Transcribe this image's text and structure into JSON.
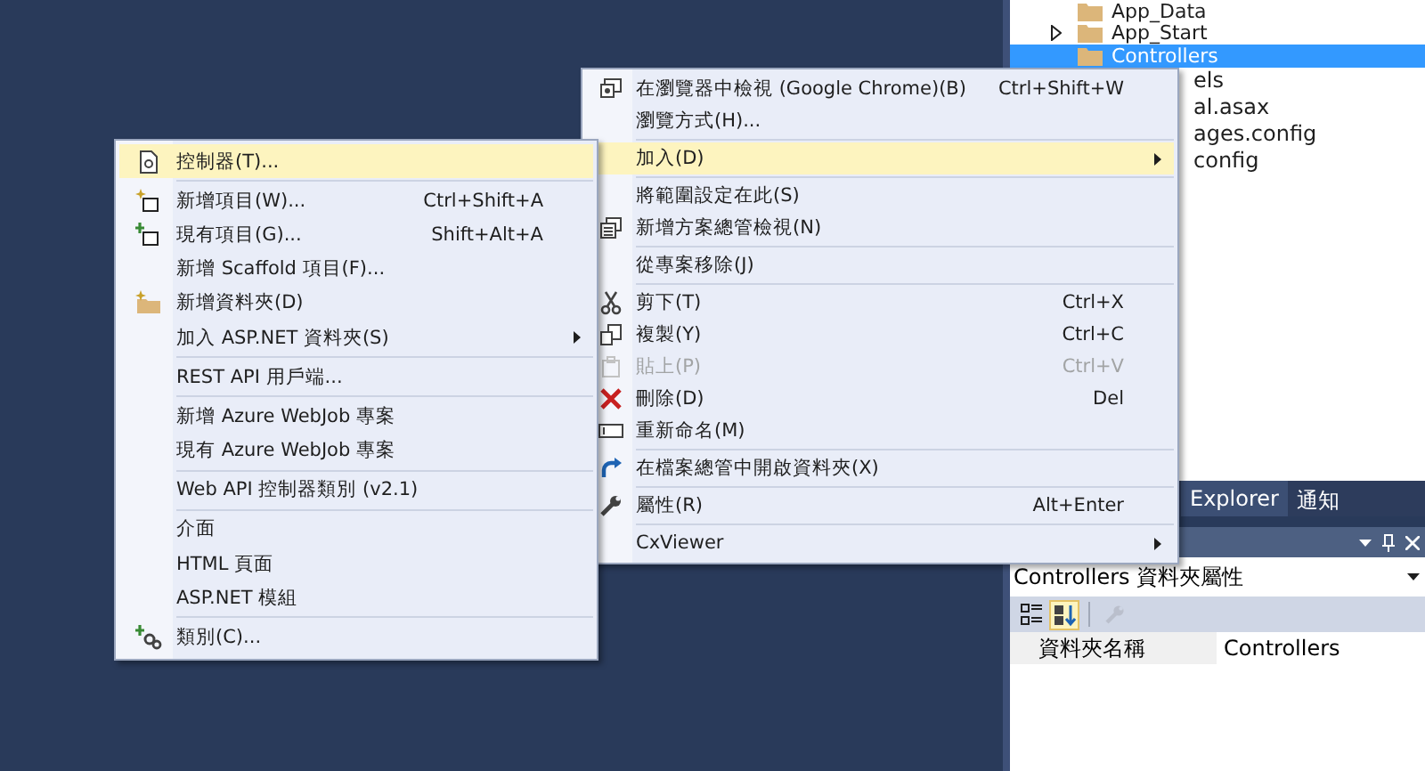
{
  "solution_explorer": {
    "items": [
      {
        "label": "App_Data",
        "kind": "folder",
        "selected": false
      },
      {
        "label": "App_Start",
        "kind": "collapsed-folder",
        "selected": false
      },
      {
        "label": "Controllers",
        "kind": "folder",
        "selected": true
      },
      {
        "label": "els",
        "kind": "partial",
        "selected": false
      },
      {
        "label": "al.asax",
        "kind": "partial",
        "selected": false
      },
      {
        "label": "ages.config",
        "kind": "partial",
        "selected": false
      },
      {
        "label": "config",
        "kind": "partial",
        "selected": false
      }
    ]
  },
  "tool_tabs": [
    {
      "label": "Explorer",
      "selected": true
    },
    {
      "label": "通知",
      "selected": false
    }
  ],
  "properties_panel": {
    "header": "Controllers 資料夾屬性",
    "toolbar": [
      {
        "kind": "categorized",
        "selected": false,
        "disabled": false
      },
      {
        "kind": "alphabetical",
        "selected": true,
        "disabled": false
      },
      {
        "kind": "property-pages",
        "selected": false,
        "disabled": true
      }
    ],
    "rows": [
      {
        "name": "資料夾名稱",
        "value": "Controllers"
      }
    ]
  },
  "menus": [
    {
      "items": [
        {
          "kind": "item",
          "label": "在瀏覽器中檢視 (Google Chrome)(B)",
          "shortcut": "Ctrl+Shift+W",
          "submenu": false,
          "selected": false,
          "disabled": false
        },
        {
          "kind": "item",
          "label": "瀏覽方式(H)...",
          "submenu": false,
          "selected": false,
          "disabled": false
        },
        {
          "kind": "separator"
        },
        {
          "kind": "item",
          "label": "加入(D)",
          "submenu": true,
          "selected": true,
          "disabled": false
        },
        {
          "kind": "separator"
        },
        {
          "kind": "item",
          "label": "將範圍設定在此(S)",
          "submenu": false,
          "selected": false,
          "disabled": false
        },
        {
          "kind": "item",
          "label": "新增方案總管檢視(N)",
          "submenu": false,
          "selected": false,
          "disabled": false
        },
        {
          "kind": "separator"
        },
        {
          "kind": "item",
          "label": "從專案移除(J)",
          "submenu": false,
          "selected": false,
          "disabled": false
        },
        {
          "kind": "separator"
        },
        {
          "kind": "item",
          "label": "剪下(T)",
          "shortcut": "Ctrl+X",
          "submenu": false,
          "selected": false,
          "disabled": false
        },
        {
          "kind": "item",
          "label": "複製(Y)",
          "shortcut": "Ctrl+C",
          "submenu": false,
          "selected": false,
          "disabled": false
        },
        {
          "kind": "item",
          "label": "貼上(P)",
          "shortcut": "Ctrl+V",
          "submenu": false,
          "selected": false,
          "disabled": true
        },
        {
          "kind": "item",
          "label": "刪除(D)",
          "shortcut": "Del",
          "submenu": false,
          "selected": false,
          "disabled": false
        },
        {
          "kind": "item",
          "label": "重新命名(M)",
          "submenu": false,
          "selected": false,
          "disabled": false
        },
        {
          "kind": "separator"
        },
        {
          "kind": "item",
          "label": "在檔案總管中開啟資料夾(X)",
          "submenu": false,
          "selected": false,
          "disabled": false
        },
        {
          "kind": "separator"
        },
        {
          "kind": "item",
          "label": "屬性(R)",
          "shortcut": "Alt+Enter",
          "submenu": false,
          "selected": false,
          "disabled": false
        },
        {
          "kind": "separator"
        },
        {
          "kind": "item",
          "label": "CxViewer",
          "submenu": true,
          "selected": false,
          "disabled": false
        }
      ]
    },
    {
      "items": [
        {
          "kind": "item",
          "label": "控制器(T)...",
          "submenu": false,
          "selected": true,
          "disabled": false
        },
        {
          "kind": "separator"
        },
        {
          "kind": "item",
          "label": "新增項目(W)...",
          "shortcut": "Ctrl+Shift+A",
          "submenu": false,
          "selected": false,
          "disabled": false
        },
        {
          "kind": "item",
          "label": "現有項目(G)...",
          "shortcut": "Shift+Alt+A",
          "submenu": false,
          "selected": false,
          "disabled": false
        },
        {
          "kind": "item",
          "label": "新增 Scaffold 項目(F)...",
          "submenu": false,
          "selected": false,
          "disabled": false
        },
        {
          "kind": "item",
          "label": "新增資料夾(D)",
          "submenu": false,
          "selected": false,
          "disabled": false
        },
        {
          "kind": "item",
          "label": "加入 ASP.NET 資料夾(S)",
          "submenu": true,
          "selected": false,
          "disabled": false
        },
        {
          "kind": "separator"
        },
        {
          "kind": "item",
          "label": "REST API 用戶端...",
          "submenu": false,
          "selected": false,
          "disabled": false
        },
        {
          "kind": "separator"
        },
        {
          "kind": "item",
          "label": "新增 Azure WebJob 專案",
          "submenu": false,
          "selected": false,
          "disabled": false
        },
        {
          "kind": "item",
          "label": "現有 Azure WebJob 專案",
          "submenu": false,
          "selected": false,
          "disabled": false
        },
        {
          "kind": "separator"
        },
        {
          "kind": "item",
          "label": "Web API 控制器類別 (v2.1)",
          "submenu": false,
          "selected": false,
          "disabled": false
        },
        {
          "kind": "separator"
        },
        {
          "kind": "item",
          "label": "介面",
          "submenu": false,
          "selected": false,
          "disabled": false
        },
        {
          "kind": "item",
          "label": "HTML 頁面",
          "submenu": false,
          "selected": false,
          "disabled": false
        },
        {
          "kind": "item",
          "label": "ASP.NET 模組",
          "submenu": false,
          "selected": false,
          "disabled": false
        },
        {
          "kind": "separator"
        },
        {
          "kind": "item",
          "label": "類別(C)...",
          "submenu": false,
          "selected": false,
          "disabled": false
        }
      ]
    }
  ]
}
